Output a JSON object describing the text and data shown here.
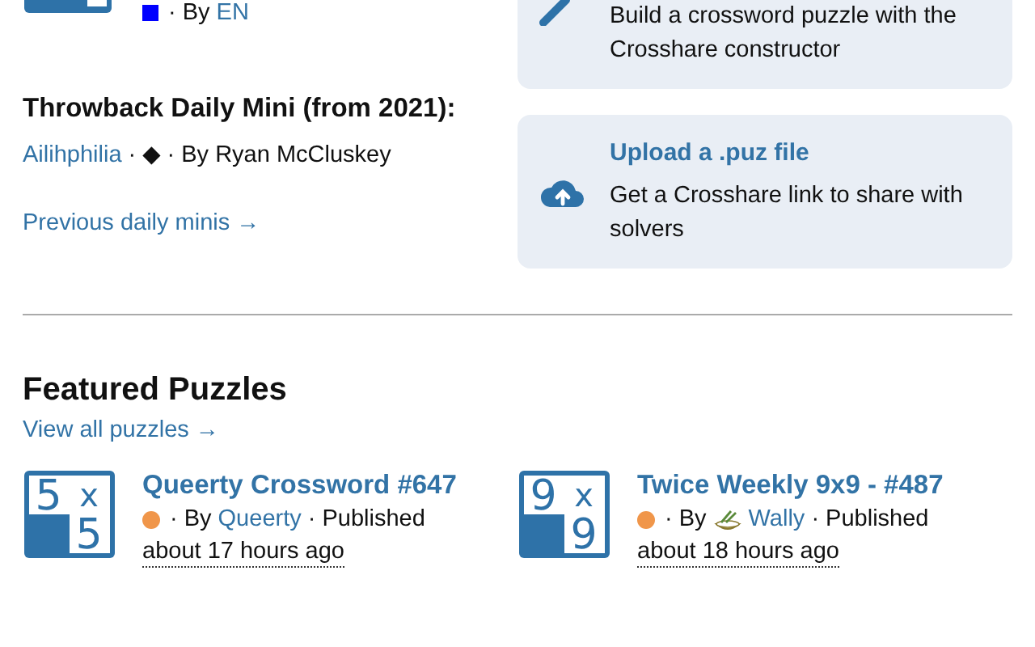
{
  "daily_mini": {
    "difficulty": {
      "color": "#0000ff"
    },
    "by": "· By",
    "author": "EN"
  },
  "throwback": {
    "heading": "Throwback Daily Mini (from 2021):",
    "title": "Ailihphilia",
    "sep": "·",
    "difficulty_symbol": "◆",
    "by": "· By Ryan McCluskey"
  },
  "previous_link": "Previous daily minis →",
  "cards": [
    {
      "kind": "create",
      "description": "Build a crossword puzzle with the\nCrosshare constructor"
    },
    {
      "kind": "upload",
      "title": "Upload a .puz file",
      "description": "Get a Crosshare link to share with\nsolvers"
    }
  ],
  "featured": {
    "heading": "Featured Puzzles",
    "view_all": "View all puzzles →",
    "puzzles": [
      {
        "icon_label": [
          "5",
          "x",
          "5"
        ],
        "title": "Queerty Crossword #647",
        "difficulty": {
          "color": "#f0964a"
        },
        "by": "· By",
        "author": "Queerty",
        "author_avatar": false,
        "status": "· Published",
        "time": "about 17 hours ago"
      },
      {
        "icon_label": [
          "9",
          "x",
          "9"
        ],
        "title": "Twice Weekly 9x9 - #487",
        "difficulty": {
          "color": "#f0964a"
        },
        "by": "· By",
        "author": "Wally",
        "author_avatar": true,
        "status": "· Published",
        "time": "about 18 hours ago"
      }
    ]
  }
}
